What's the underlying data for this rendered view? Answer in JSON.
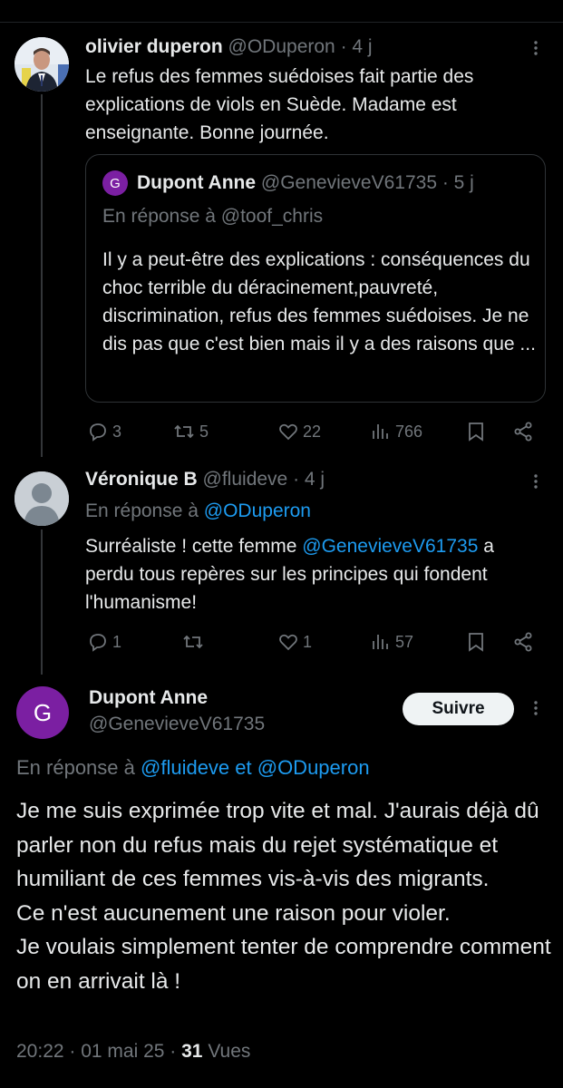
{
  "colors": {
    "background": "#000000",
    "text": "#e7e9ea",
    "muted": "#71767b",
    "link": "#1d9bf0",
    "avatar_purple": "#7b1fa2"
  },
  "tweet1": {
    "author_name": "olivier duperon",
    "handle": "@ODuperon",
    "age": "· 4 j",
    "text": "Le refus des femmes suédoises fait partie des explications de viols en Suède. Madame est enseignante. Bonne journée.",
    "quote": {
      "avatar_letter": "G",
      "author_name": "Dupont Anne",
      "handle": "@GenevieveV61735",
      "age": "· 5 j",
      "reply_to": "En réponse à @toof_chris",
      "text": "Il y a peut-être des explications : conséquences du choc terrible du déracinement,pauvreté, discrimination, refus des femmes suédoises. Je ne dis pas que c'est bien mais il  y a des raisons que ..."
    },
    "stats": {
      "replies": "3",
      "reposts": "5",
      "likes": "22",
      "views": "766"
    }
  },
  "tweet2": {
    "author_name": "Véronique B",
    "handle": "@fluideve",
    "age": "· 4 j",
    "reply_prefix": "En réponse à",
    "reply_to": "@ODuperon",
    "text_part1": "Surréaliste ! cette femme",
    "mention": "@GenevieveV61735",
    "text_part2": "a perdu tous repères sur les principes qui fondent l'humanisme!",
    "stats": {
      "replies": "1",
      "reposts": "",
      "likes": "1",
      "views": "57"
    }
  },
  "main": {
    "avatar_letter": "G",
    "author_name": "Dupont Anne",
    "handle": "@GenevieveV61735",
    "follow_label": "Suivre",
    "reply_prefix": "En réponse à",
    "reply_to": "@fluideve et @ODuperon",
    "text": "Je me suis exprimée trop vite et mal. J'aurais déjà dû parler non du refus mais du rejet systématique et humiliant de ces femmes vis-à-vis des migrants.\nCe n'est aucunement une raison pour violer.\nJe voulais simplement tenter de comprendre comment on en arrivait là !",
    "timestamp": "20:22 · 01 mai 25 ·",
    "views_count": "31",
    "views_label": "Vues"
  },
  "icons": [
    "reply-icon",
    "repost-icon",
    "like-icon",
    "views-icon",
    "bookmark-icon",
    "share-icon",
    "more-icon"
  ]
}
